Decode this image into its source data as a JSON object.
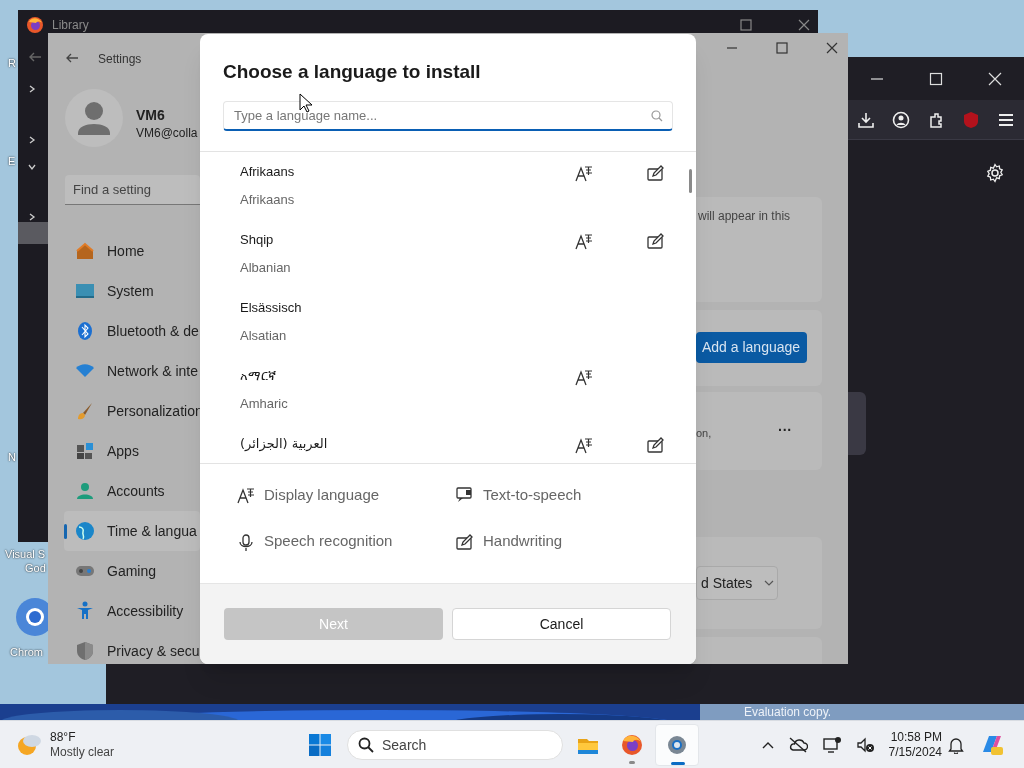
{
  "desktop": {
    "icon_labels": [
      "R",
      "E",
      "N",
      "Visual S",
      "God",
      "Chrom"
    ],
    "build_notice": "Evaluation copy."
  },
  "library_window": {
    "title": "Library"
  },
  "settings_window": {
    "title": "Settings",
    "user": {
      "name": "VM6",
      "email": "VM6@colla"
    },
    "search": {
      "placeholder": "Find a setting"
    },
    "nav": [
      {
        "label": "Home",
        "selected": false
      },
      {
        "label": "System",
        "selected": false
      },
      {
        "label": "Bluetooth & de",
        "selected": false
      },
      {
        "label": "Network & inte",
        "selected": false
      },
      {
        "label": "Personalization",
        "selected": false
      },
      {
        "label": "Apps",
        "selected": false
      },
      {
        "label": "Accounts",
        "selected": false
      },
      {
        "label": "Time & langua",
        "selected": true
      },
      {
        "label": "Gaming",
        "selected": false
      },
      {
        "label": "Accessibility",
        "selected": false
      },
      {
        "label": "Privacy & secu",
        "selected": false
      }
    ],
    "content": {
      "card_text": "will appear in this",
      "add_button": "Add a language",
      "card_text_2": "on,",
      "more_button": "···",
      "region_dropdown": "d States"
    }
  },
  "dialog": {
    "title": "Choose a language to install",
    "search": {
      "placeholder": "Type a language name..."
    },
    "languages": [
      {
        "name": "Afrikaans",
        "english": "Afrikaans",
        "display_language": true,
        "handwriting": true
      },
      {
        "name": "Shqip",
        "english": "Albanian",
        "display_language": true,
        "handwriting": true
      },
      {
        "name": "Elsässisch",
        "english": "Alsatian",
        "display_language": false,
        "handwriting": false
      },
      {
        "name": "አማርኛ",
        "english": "Amharic",
        "display_language": true,
        "handwriting": false
      },
      {
        "name": "العربية (الجزائر)",
        "display_language": true,
        "handwriting": true
      }
    ],
    "legend": [
      {
        "kind": "display",
        "label": "Display language"
      },
      {
        "kind": "tts",
        "label": "Text-to-speech"
      },
      {
        "kind": "speech",
        "label": "Speech recognition"
      },
      {
        "kind": "handwriting",
        "label": "Handwriting"
      }
    ],
    "buttons": [
      {
        "label": "Next",
        "disabled": true
      },
      {
        "label": "Cancel",
        "disabled": false
      }
    ]
  },
  "taskbar": {
    "weather": {
      "temperature": "88°F",
      "condition": "Mostly clear"
    },
    "search": "Search",
    "apps": [
      {
        "kind": "explorer",
        "selected": false,
        "running": false
      },
      {
        "kind": "firefox",
        "selected": false,
        "running": true
      },
      {
        "kind": "settings",
        "selected": true,
        "running": true
      }
    ],
    "clock": {
      "time": "10:58 PM",
      "date": "7/15/2024"
    }
  }
}
